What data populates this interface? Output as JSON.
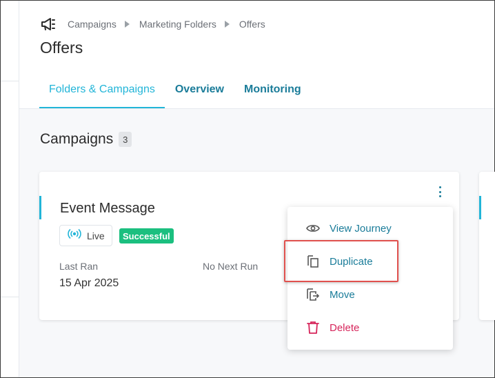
{
  "breadcrumb": {
    "icon": "megaphone-icon",
    "items": [
      "Campaigns",
      "Marketing Folders",
      "Offers"
    ]
  },
  "page": {
    "title": "Offers"
  },
  "tabs": [
    {
      "label": "Folders & Campaigns",
      "active": true
    },
    {
      "label": "Overview",
      "active": false
    },
    {
      "label": "Monitoring",
      "active": false
    }
  ],
  "campaigns": {
    "title": "Campaigns",
    "count": "3",
    "card": {
      "title": "Event Message",
      "status_badge": "Live",
      "result_badge": "Successful",
      "last_ran_label": "Last Ran",
      "last_ran_value": "15 Apr 2025",
      "next_run_label": "No Next Run"
    }
  },
  "menu": {
    "items": [
      {
        "label": "View Journey",
        "icon": "eye-icon"
      },
      {
        "label": "Duplicate",
        "icon": "duplicate-icon"
      },
      {
        "label": "Move",
        "icon": "move-icon"
      },
      {
        "label": "Delete",
        "icon": "trash-icon"
      }
    ]
  },
  "colors": {
    "accent": "#22b5d8",
    "link": "#1a7c99",
    "success": "#1bbf7f",
    "danger": "#d6245a",
    "highlight": "#e0504d"
  }
}
